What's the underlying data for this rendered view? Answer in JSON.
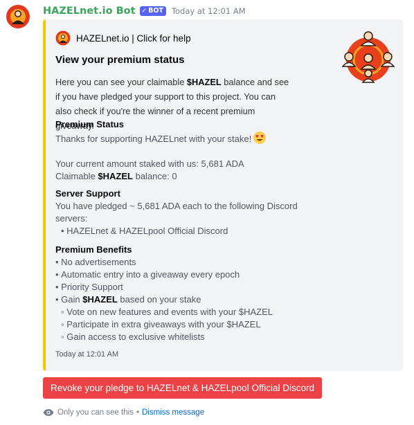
{
  "message": {
    "username": "HAZELnet.io Bot",
    "bot_badge": "BOT",
    "timestamp": "Today at 12:01 AM"
  },
  "embed": {
    "accent_color": "#f2c800",
    "author": "HAZELnet.io | Click for help",
    "title": "View your premium status",
    "description": {
      "part1": "Here you can see your claimable ",
      "token": "$HAZEL",
      "part2": " balance and see if you have pledged your support to this project. You can also check if you're the winner of a recent premium giveaway."
    },
    "fields": {
      "premium_status": {
        "name": "Premium Status",
        "thanks": "Thanks for supporting HAZELnet with your stake!",
        "emoji": "heart-eyes-emoji",
        "staked": "Your current amount staked with us: 5,681 ADA",
        "claimable_prefix": "Claimable ",
        "claimable_token": "$HAZEL",
        "claimable_suffix": " balance: 0"
      },
      "server_support": {
        "name": "Server Support",
        "pledge_text": "You have pledged ~ 5,681 ADA each to the following Discord servers:",
        "servers": [
          "HAZELnet & HAZELpool Official Discord"
        ]
      },
      "premium_benefits": {
        "name": "Premium Benefits",
        "items": [
          "No advertisements",
          "Automatic entry into a giveaway every epoch",
          "Priority Support"
        ],
        "gain_prefix": "Gain ",
        "gain_token": "$HAZEL",
        "gain_suffix": " based on your stake",
        "sub_items": [
          "Vote on new features and events with your $HAZEL",
          "Participate in extra giveaways with your $HAZEL",
          "Gain access to exclusive whitelists"
        ]
      }
    },
    "footer": "Today at 12:01 AM"
  },
  "revoke_button": "Revoke your pledge to HAZELnet & HAZELpool Official Discord",
  "ephemeral": {
    "notice": "Only you can see this",
    "separator": "•",
    "dismiss": "Dismiss message"
  }
}
